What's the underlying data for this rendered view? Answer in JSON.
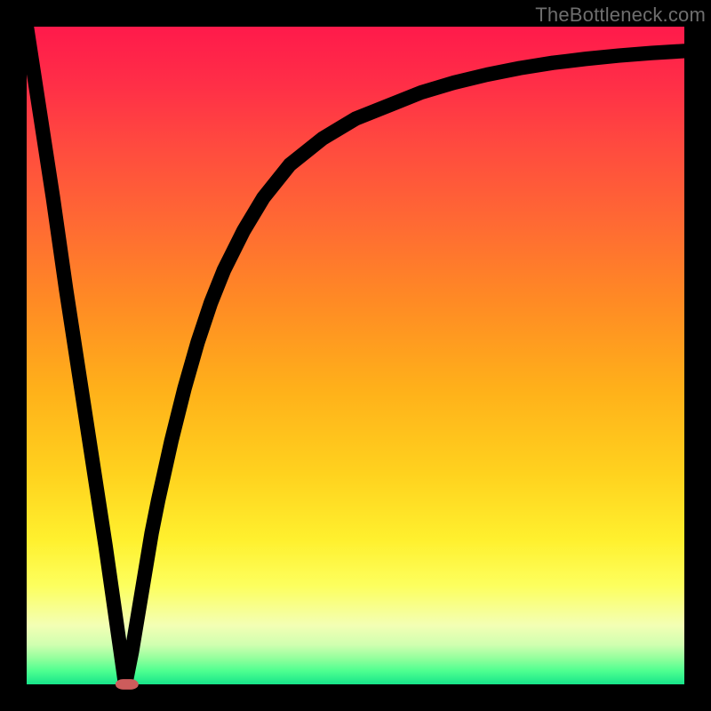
{
  "watermark": "TheBottleneck.com",
  "colors": {
    "frame": "#000000",
    "curve": "#000000",
    "marker": "#cd5c5c",
    "watermark": "#6e6e6e"
  },
  "chart_data": {
    "type": "line",
    "title": "",
    "xlabel": "",
    "ylabel": "",
    "xlim": [
      0,
      100
    ],
    "ylim": [
      0,
      100
    ],
    "grid": false,
    "legend": false,
    "series": [
      {
        "name": "bottleneck-curve",
        "x": [
          0,
          2,
          4,
          6,
          8,
          10,
          12,
          14,
          15,
          16,
          17,
          18,
          19,
          20,
          22,
          24,
          26,
          28,
          30,
          33,
          36,
          40,
          45,
          50,
          55,
          60,
          65,
          70,
          75,
          80,
          85,
          90,
          95,
          100
        ],
        "y": [
          100,
          87,
          74,
          60,
          47,
          34,
          21,
          7,
          0,
          5,
          11,
          17,
          23,
          28,
          37,
          45,
          52,
          58,
          63,
          69,
          74,
          79,
          83,
          86,
          88,
          90,
          91.5,
          92.7,
          93.7,
          94.5,
          95.1,
          95.6,
          96,
          96.3
        ]
      }
    ],
    "marker": {
      "name": "optimal-zone",
      "x_start": 13.5,
      "x_end": 17,
      "y": 0,
      "rx": 1.2
    }
  }
}
